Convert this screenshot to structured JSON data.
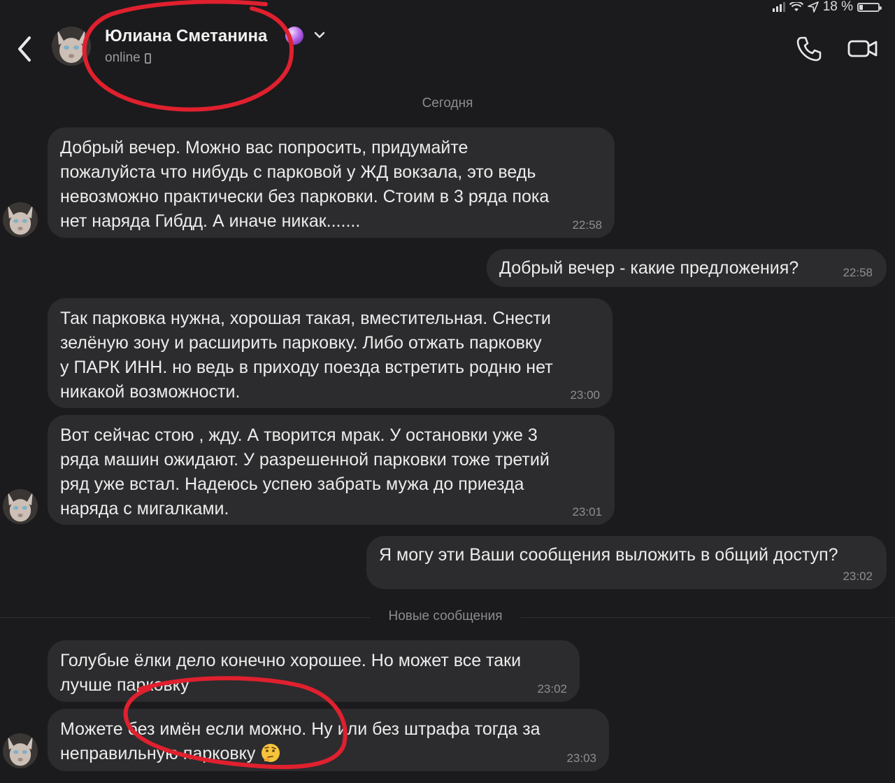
{
  "status_bar": {
    "battery_text": "18 %",
    "battery_level": 0.18
  },
  "header": {
    "contact_name": "Юлиана Сметанина",
    "status": "online",
    "icons": {
      "back": "chevron-left-icon",
      "emoji": "crystal-ball-icon",
      "dropdown": "chevron-down-icon",
      "call": "phone-icon",
      "video": "video-camera-icon"
    }
  },
  "date_separator": "Сегодня",
  "new_messages_separator": "Новые сообщения",
  "messages": [
    {
      "direction": "in",
      "text": "Добрый вечер.  Можно вас попросить,  придумайте\nпожалуйста что нибудь с парковой у ЖД вокзала, это ведь\nневозможно практически без парковки. Стоим в 3 ряда пока\nнет наряда Гибдд. А иначе никак.......",
      "time": "22:58"
    },
    {
      "direction": "out",
      "text": "Добрый вечер - какие предложения?",
      "time": "22:58"
    },
    {
      "direction": "in",
      "text": "Так парковка нужна, хорошая такая, вместительная. Снести\nзелёную зону и расширить парковку. Либо отжать парковку\nу ПАРК ИНН. но ведь в приходу поезда встретить родню нет\nникакой возможности.",
      "time": "23:00"
    },
    {
      "direction": "in",
      "text": "Вот сейчас стою , жду. А творится мрак. У остановки уже 3\nряда машин ожидают. У разрешенной парковки тоже третий\nряд уже встал. Надеюсь успею забрать мужа до приезда\nнаряда с мигалками.",
      "time": "23:01"
    },
    {
      "direction": "out",
      "text": "Я могу эти Ваши сообщения выложить в общий доступ?",
      "time": "23:02"
    },
    {
      "direction": "in",
      "text": "Голубые ёлки дело конечно хорошее. Но может все таки\nлучше парковку",
      "time": "23:02"
    },
    {
      "direction": "in",
      "text": "Можете  без имён если можно. Ну или без штрафа тогда за\nнеправильную парковку",
      "emoji": "thinking-face-icon",
      "time": "23:03"
    }
  ],
  "annotation_color": "#e0202e"
}
